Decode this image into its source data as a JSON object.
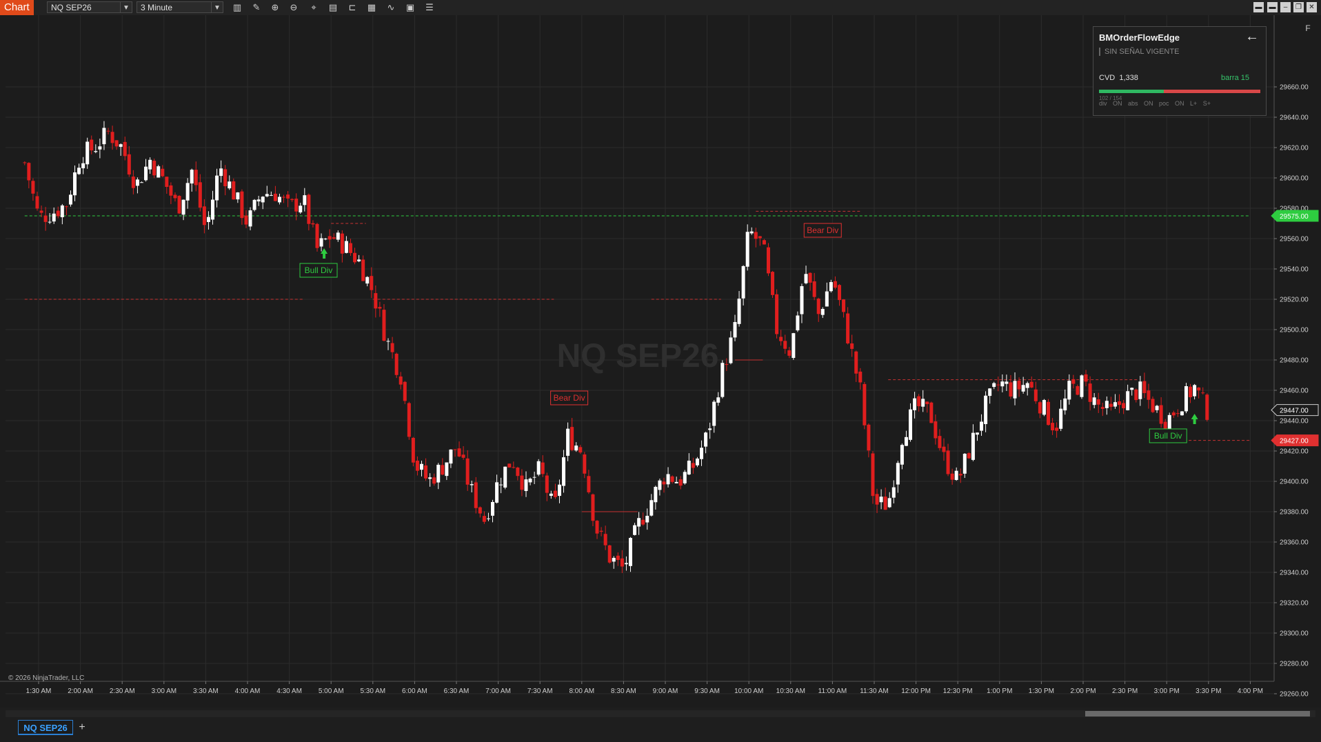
{
  "toolbar": {
    "chart_tab_label": "Chart",
    "instrument": "NQ SEP26",
    "interval": "3 Minute",
    "icons": [
      "bar-style-icon",
      "drawing-tools-icon",
      "zoom-in-icon",
      "zoom-out-icon",
      "crosshair-icon",
      "properties-icon",
      "chart-trader-icon",
      "data-box-icon",
      "indicators-icon",
      "strategies-icon",
      "templates-icon"
    ],
    "window_icons": [
      "tile-icon",
      "tile-alt-icon",
      "minimize-icon",
      "restore-icon",
      "close-icon"
    ]
  },
  "watermark": "NQ SEP26",
  "copyright": "© 2026 NinjaTrader, LLC",
  "right_corner_label": "F",
  "indicator_panel": {
    "title": "BMOrderFlowEdge",
    "signal": "SIN SEÑAL VIGENTE",
    "cvd_label": "CVD",
    "cvd_value": "1,338",
    "bar_label": "barra 15",
    "ratio": "102 / 154",
    "ratio_fraction": 0.4,
    "flags": "div ON  abs ON  poc ON  L+ S+",
    "colors": {
      "buy": "#2fb862",
      "sell": "#d84848"
    }
  },
  "tabs": {
    "active": "NQ SEP26",
    "add_label": "+"
  },
  "price_markers": {
    "green": {
      "value": "29575.00",
      "color": "#2ecc40"
    },
    "current": {
      "value": "29447.00"
    },
    "red": {
      "value": "29427.00",
      "color": "#e03030"
    }
  },
  "chart_data": {
    "type": "candlestick",
    "symbol": "NQ SEP26",
    "interval": "3 Minute",
    "ylim": [
      29250,
      29680
    ],
    "y_ticks": [
      "29660.00",
      "29640.00",
      "29620.00",
      "29600.00",
      "29580.00",
      "29560.00",
      "29540.00",
      "29520.00",
      "29500.00",
      "29480.00",
      "29460.00",
      "29440.00",
      "29420.00",
      "29400.00",
      "29380.00",
      "29360.00",
      "29340.00",
      "29320.00",
      "29300.00",
      "29280.00",
      "29260.00"
    ],
    "x_ticks": [
      "1:30 AM",
      "2:00 AM",
      "2:30 AM",
      "3:00 AM",
      "3:30 AM",
      "4:00 AM",
      "4:30 AM",
      "5:00 AM",
      "5:30 AM",
      "6:00 AM",
      "6:30 AM",
      "7:00 AM",
      "7:30 AM",
      "8:00 AM",
      "8:30 AM",
      "9:00 AM",
      "9:30 AM",
      "10:00 AM",
      "10:30 AM",
      "11:00 AM",
      "11:30 AM",
      "12:00 PM",
      "12:30 PM",
      "1:00 PM",
      "1:30 PM",
      "2:00 PM",
      "2:30 PM",
      "3:00 PM",
      "3:30 PM",
      "4:00 PM"
    ],
    "close_path": [
      [
        "1:20 AM",
        29610
      ],
      [
        "1:30 AM",
        29574
      ],
      [
        "1:40 AM",
        29577
      ],
      [
        "1:50 AM",
        29583
      ],
      [
        "2:00 AM",
        29615
      ],
      [
        "2:10 AM",
        29620
      ],
      [
        "2:20 AM",
        29630
      ],
      [
        "2:30 AM",
        29620
      ],
      [
        "2:40 AM",
        29595
      ],
      [
        "2:50 AM",
        29612
      ],
      [
        "3:00 AM",
        29598
      ],
      [
        "3:10 AM",
        29580
      ],
      [
        "3:20 AM",
        29605
      ],
      [
        "3:30 AM",
        29565
      ],
      [
        "3:40 AM",
        29608
      ],
      [
        "3:50 AM",
        29590
      ],
      [
        "4:00 AM",
        29570
      ],
      [
        "4:10 AM",
        29590
      ],
      [
        "4:20 AM",
        29590
      ],
      [
        "4:30 AM",
        29580
      ],
      [
        "4:40 AM",
        29586
      ],
      [
        "4:50 AM",
        29553
      ],
      [
        "5:00 AM",
        29562
      ],
      [
        "5:10 AM",
        29555
      ],
      [
        "5:20 AM",
        29545
      ],
      [
        "5:30 AM",
        29525
      ],
      [
        "5:40 AM",
        29493
      ],
      [
        "5:50 AM",
        29470
      ],
      [
        "6:00 AM",
        29412
      ],
      [
        "6:10 AM",
        29400
      ],
      [
        "6:20 AM",
        29410
      ],
      [
        "6:30 AM",
        29423
      ],
      [
        "6:40 AM",
        29395
      ],
      [
        "6:50 AM",
        29375
      ],
      [
        "7:00 AM",
        29400
      ],
      [
        "7:10 AM",
        29415
      ],
      [
        "7:20 AM",
        29395
      ],
      [
        "7:30 AM",
        29408
      ],
      [
        "7:40 AM",
        29380
      ],
      [
        "7:50 AM",
        29430
      ],
      [
        "8:00 AM",
        29420
      ],
      [
        "8:10 AM",
        29370
      ],
      [
        "8:20 AM",
        29350
      ],
      [
        "8:30 AM",
        29342
      ],
      [
        "8:40 AM",
        29370
      ],
      [
        "8:50 AM",
        29388
      ],
      [
        "9:00 AM",
        29405
      ],
      [
        "9:10 AM",
        29400
      ],
      [
        "9:20 AM",
        29410
      ],
      [
        "9:30 AM",
        29430
      ],
      [
        "9:40 AM",
        29470
      ],
      [
        "9:50 AM",
        29500
      ],
      [
        "10:00 AM",
        29565
      ],
      [
        "10:10 AM",
        29555
      ],
      [
        "10:20 AM",
        29500
      ],
      [
        "10:30 AM",
        29485
      ],
      [
        "10:40 AM",
        29540
      ],
      [
        "10:50 AM",
        29510
      ],
      [
        "11:00 AM",
        29535
      ],
      [
        "11:10 AM",
        29500
      ],
      [
        "11:20 AM",
        29460
      ],
      [
        "11:30 AM",
        29385
      ],
      [
        "11:40 AM",
        29385
      ],
      [
        "11:50 AM",
        29430
      ],
      [
        "12:00 PM",
        29450
      ],
      [
        "12:10 PM",
        29445
      ],
      [
        "12:20 PM",
        29415
      ],
      [
        "12:30 PM",
        29400
      ],
      [
        "12:40 PM",
        29425
      ],
      [
        "12:50 PM",
        29450
      ],
      [
        "1:00 PM",
        29465
      ],
      [
        "1:10 PM",
        29460
      ],
      [
        "1:20 PM",
        29465
      ],
      [
        "1:30 PM",
        29450
      ],
      [
        "1:40 PM",
        29435
      ],
      [
        "1:50 PM",
        29460
      ],
      [
        "2:00 PM",
        29465
      ],
      [
        "2:10 PM",
        29450
      ],
      [
        "2:20 PM",
        29445
      ],
      [
        "2:30 PM",
        29455
      ],
      [
        "2:40 PM",
        29460
      ],
      [
        "2:50 PM",
        29450
      ],
      [
        "3:00 PM",
        29440
      ],
      [
        "3:10 PM",
        29452
      ],
      [
        "3:20 PM",
        29462
      ],
      [
        "3:30 PM",
        29445
      ]
    ],
    "annotations": [
      {
        "text": "Bull Div",
        "time": "4:51 AM",
        "kind": "bull",
        "arrow": "4:55 AM"
      },
      {
        "text": "Bear Div",
        "time": "7:51 AM",
        "kind": "bear"
      },
      {
        "text": "Bear Div",
        "time": "10:53 AM",
        "kind": "bear"
      },
      {
        "text": "Bull Div",
        "time": "3:01 PM",
        "kind": "bull",
        "arrow": "3:20 PM"
      }
    ],
    "levels": [
      {
        "price": 29575,
        "color": "#2ecc40",
        "style": "dashed",
        "from": "1:20 AM",
        "to": "4:00 PM"
      },
      {
        "price": 29520,
        "color": "#c83232",
        "style": "dashed",
        "from": "1:20 AM",
        "to": "4:40 AM"
      },
      {
        "price": 29520,
        "color": "#c83232",
        "style": "dashed",
        "from": "5:30 AM",
        "to": "7:40 AM"
      },
      {
        "price": 29520,
        "color": "#c83232",
        "style": "dashed",
        "from": "8:50 AM",
        "to": "9:40 AM"
      },
      {
        "price": 29570,
        "color": "#c83232",
        "style": "dashed",
        "from": "5:00 AM",
        "to": "5:25 AM"
      },
      {
        "price": 29578,
        "color": "#c83232",
        "style": "dashed",
        "from": "10:05 AM",
        "to": "11:20 AM"
      },
      {
        "price": 29467,
        "color": "#c83232",
        "style": "dashed",
        "from": "11:40 AM",
        "to": "2:40 PM"
      },
      {
        "price": 29427,
        "color": "#c83232",
        "style": "dashed",
        "from": "2:55 PM",
        "to": "4:00 PM"
      },
      {
        "price": 29380,
        "color": "#c83232",
        "style": "solid",
        "from": "8:00 AM",
        "to": "8:40 AM"
      },
      {
        "price": 29480,
        "color": "#c83232",
        "style": "solid",
        "from": "9:50 AM",
        "to": "10:10 AM"
      }
    ],
    "colors": {
      "up": "#ffffff",
      "down": "#e01e1e",
      "grid": "#2c2c2c",
      "background": "#1c1c1c"
    }
  }
}
